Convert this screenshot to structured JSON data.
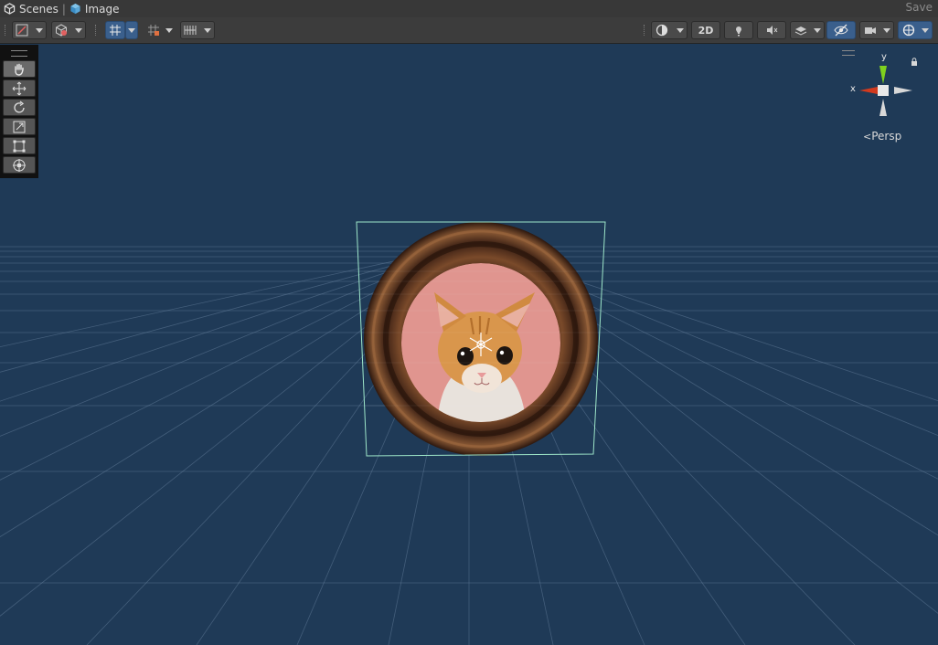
{
  "breadcrumb": {
    "scene_label": "Scenes",
    "object_label": "Image",
    "save_label": "Save"
  },
  "toolbar": {
    "mode_2d_label": "2D"
  },
  "scene_gizmo": {
    "y_label": "y",
    "x_label": "x",
    "projection_label": "Persp"
  },
  "colors": {
    "viewport_bg": "#1f3a57",
    "toolbar_bg": "#3c3c3c",
    "active_blue": "#3a5f8c",
    "selection_outline": "#9ee6c9",
    "axis_x": "#d23a1e",
    "axis_y": "#7fd11e",
    "pink_bg": "#e0958f"
  },
  "icons": {
    "unity-icon": "unity-icon",
    "cube-icon": "cube-icon"
  }
}
